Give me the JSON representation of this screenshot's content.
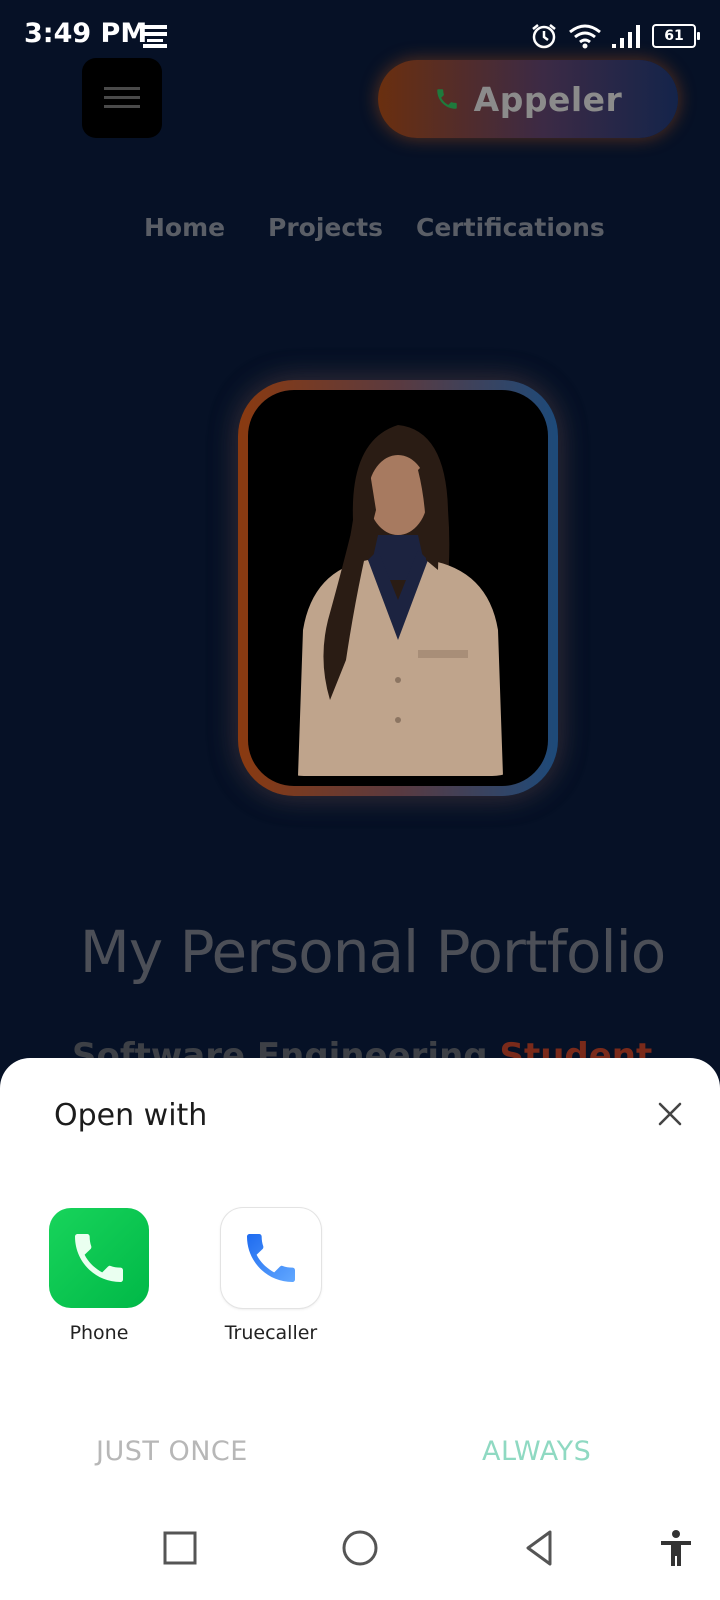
{
  "status_bar": {
    "time": "3:49 PM",
    "battery": "61",
    "icons": [
      "notification-icon",
      "alarm-icon",
      "wifi-icon",
      "signal-icon",
      "battery-icon"
    ]
  },
  "site": {
    "call_button_label": "Appeler",
    "nav": [
      "Home",
      "Projects",
      "Certifications"
    ],
    "title": "My Personal Portfolio",
    "subtitle_main": "Software Engineering ",
    "subtitle_accent": "Student"
  },
  "sheet": {
    "title": "Open with",
    "apps": [
      {
        "label": "Phone",
        "icon": "phone-app-icon"
      },
      {
        "label": "Truecaller",
        "icon": "truecaller-app-icon"
      }
    ],
    "just_once": "JUST ONCE",
    "always": "ALWAYS"
  },
  "nav_bar": [
    "recents",
    "home",
    "back",
    "accessibility"
  ],
  "colors": {
    "background": "#061126",
    "accent_always": "#8fd9c2",
    "phone_green": "#00c853",
    "truecaller_blue": "#2f7cf6"
  }
}
